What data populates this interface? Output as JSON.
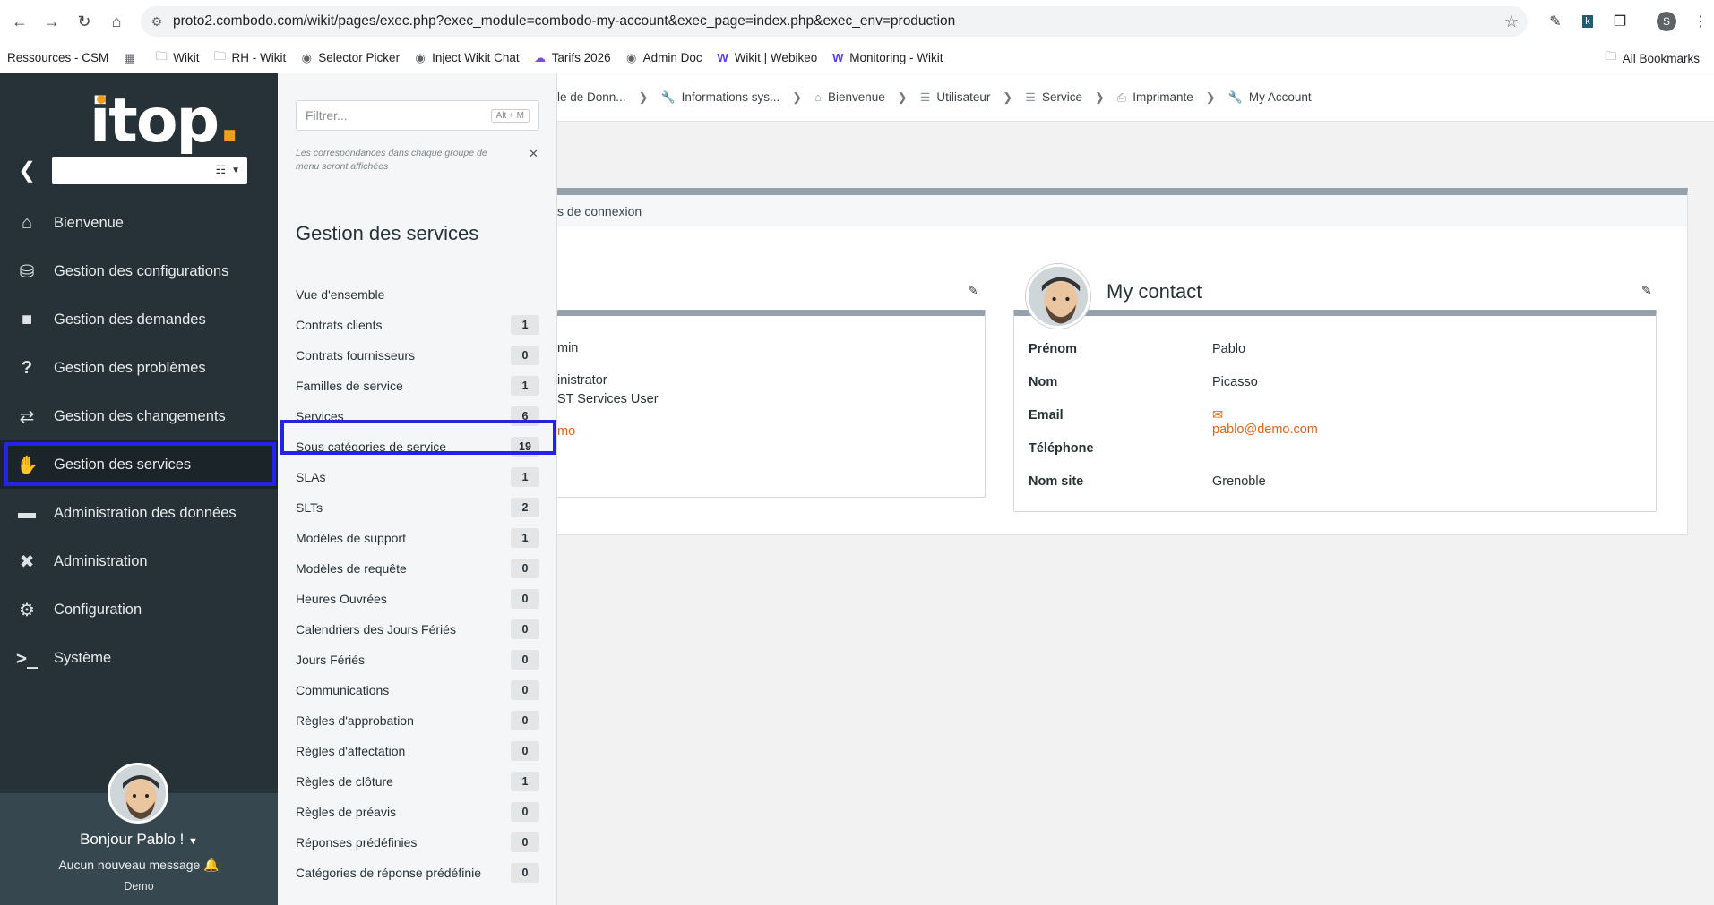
{
  "browser": {
    "url": "proto2.combodo.com/wikit/pages/exec.php?exec_module=combodo-my-account&exec_page=index.php&exec_env=production",
    "profile_initial": "S",
    "bookmarks": [
      {
        "label": "Ressources - CSM",
        "icon": ""
      },
      {
        "label": "",
        "icon": "apps-grid-icon"
      },
      {
        "label": "Wikit",
        "icon": "folder-icon"
      },
      {
        "label": "RH - Wikit",
        "icon": "folder-icon"
      },
      {
        "label": "Selector Picker",
        "icon": "globe-icon"
      },
      {
        "label": "Inject Wikit Chat",
        "icon": "globe-icon"
      },
      {
        "label": "Tarifs 2026",
        "icon": "cloud-icon"
      },
      {
        "label": "Admin Doc",
        "icon": "globe-icon"
      },
      {
        "label": "Wikit | Webikeo",
        "icon": "w-logo-icon"
      },
      {
        "label": "Monitoring - Wikit",
        "icon": "w-logo-icon"
      }
    ],
    "all_bookmarks": "All Bookmarks"
  },
  "sidebar": {
    "logo": "itop",
    "items": [
      {
        "label": "Bienvenue",
        "icon": "home-icon"
      },
      {
        "label": "Gestion des configurations",
        "icon": "database-icon"
      },
      {
        "label": "Gestion des demandes",
        "icon": "comment-icon"
      },
      {
        "label": "Gestion des problèmes",
        "icon": "question-icon"
      },
      {
        "label": "Gestion des changements",
        "icon": "exchange-icon"
      },
      {
        "label": "Gestion des services",
        "icon": "handshake-icon"
      },
      {
        "label": "Administration des données",
        "icon": "folder-icon"
      },
      {
        "label": "Administration",
        "icon": "tools-icon"
      },
      {
        "label": "Configuration",
        "icon": "gear-icon"
      },
      {
        "label": "Système",
        "icon": "terminal-icon"
      }
    ],
    "user": {
      "greeting": "Bonjour Pablo !",
      "messages": "Aucun nouveau message",
      "org": "Demo"
    }
  },
  "flyout": {
    "filter_placeholder": "Filtrer...",
    "filter_shortcut": "Alt + M",
    "hint": "Les correspondances dans chaque groupe de menu seront affichées",
    "title": "Gestion des services",
    "items": [
      {
        "label": "Vue d'ensemble",
        "count": ""
      },
      {
        "label": "Contrats clients",
        "count": "1"
      },
      {
        "label": "Contrats fournisseurs",
        "count": "0"
      },
      {
        "label": "Familles de service",
        "count": "1"
      },
      {
        "label": "Services",
        "count": "6"
      },
      {
        "label": "Sous catégories de service",
        "count": "19"
      },
      {
        "label": "SLAs",
        "count": "1"
      },
      {
        "label": "SLTs",
        "count": "2"
      },
      {
        "label": "Modèles de support",
        "count": "1"
      },
      {
        "label": "Modèles de requête",
        "count": "0"
      },
      {
        "label": "Heures Ouvrées",
        "count": "0"
      },
      {
        "label": "Calendriers des Jours Fériés",
        "count": "0"
      },
      {
        "label": "Jours Fériés",
        "count": "0"
      },
      {
        "label": "Communications",
        "count": "0"
      },
      {
        "label": "Règles d'approbation",
        "count": "0"
      },
      {
        "label": "Règles d'affectation",
        "count": "0"
      },
      {
        "label": "Règles de clôture",
        "count": "1"
      },
      {
        "label": "Règles de préavis",
        "count": "0"
      },
      {
        "label": "Réponses prédéfinies",
        "count": "0"
      },
      {
        "label": "Catégories de réponse prédéfinie",
        "count": "0"
      }
    ]
  },
  "breadcrumb": [
    {
      "label": "le de Donn...",
      "icon": ""
    },
    {
      "label": "Informations sys...",
      "icon": "wrench-icon"
    },
    {
      "label": "Bienvenue",
      "icon": "home-icon"
    },
    {
      "label": "Utilisateur",
      "icon": "list-icon"
    },
    {
      "label": "Service",
      "icon": "list-icon"
    },
    {
      "label": "Imprimante",
      "icon": "printer-icon"
    },
    {
      "label": "My Account",
      "icon": "wrench-icon"
    }
  ],
  "main": {
    "tab_fragment": "s de connexion",
    "user_card": {
      "frag1": "min",
      "frag2": "inistrator",
      "frag3": "ST Services User",
      "frag4": "mo"
    },
    "contact": {
      "title": "My contact",
      "fields": [
        {
          "label": "Prénom",
          "value": "Pablo"
        },
        {
          "label": "Nom",
          "value": "Picasso"
        },
        {
          "label": "Email",
          "value": "pablo@demo.com"
        },
        {
          "label": "Téléphone",
          "value": ""
        },
        {
          "label": "Nom site",
          "value": "Grenoble"
        }
      ]
    }
  },
  "colors": {
    "accent": "#ea7d1e",
    "highlight": "#2424e6",
    "nav_bg": "#263238"
  }
}
